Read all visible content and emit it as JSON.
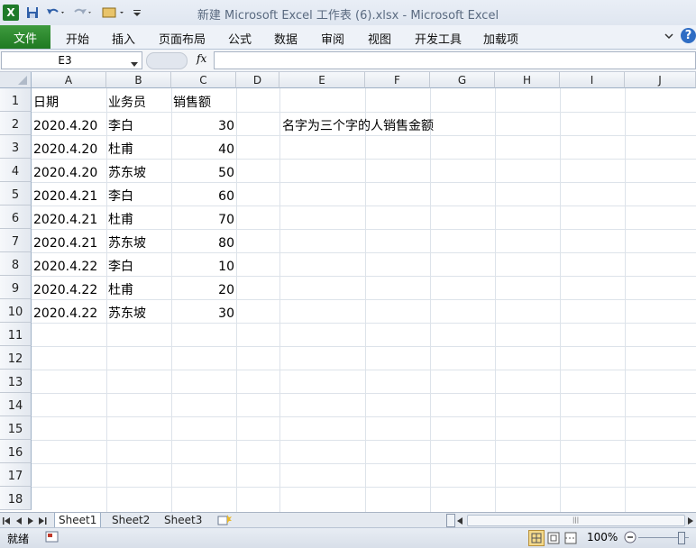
{
  "window": {
    "title": "新建 Microsoft Excel 工作表 (6).xlsx  -  Microsoft Excel"
  },
  "qat": {
    "save_icon": "save-icon",
    "undo_icon": "undo-icon",
    "redo_icon": "redo-icon"
  },
  "ribbon": {
    "file_tab": "文件",
    "tabs": [
      "开始",
      "插入",
      "页面布局",
      "公式",
      "数据",
      "审阅",
      "视图",
      "开发工具",
      "加载项"
    ]
  },
  "formula_bar": {
    "name_box": "E3",
    "fx": "fx",
    "value": ""
  },
  "columns": [
    "A",
    "B",
    "C",
    "D",
    "E",
    "F",
    "G",
    "H",
    "I",
    "J"
  ],
  "rows": [
    "1",
    "2",
    "3",
    "4",
    "5",
    "6",
    "7",
    "8",
    "9",
    "10",
    "11",
    "12",
    "13",
    "14",
    "15",
    "16",
    "17",
    "18"
  ],
  "cells": {
    "headers": [
      "日期",
      "业务员",
      "销售额"
    ],
    "data": [
      [
        "2020.4.20",
        "李白",
        "30"
      ],
      [
        "2020.4.20",
        "杜甫",
        "40"
      ],
      [
        "2020.4.20",
        "苏东坡",
        "50"
      ],
      [
        "2020.4.21",
        "李白",
        "60"
      ],
      [
        "2020.4.21",
        "杜甫",
        "70"
      ],
      [
        "2020.4.21",
        "苏东坡",
        "80"
      ],
      [
        "2020.4.22",
        "李白",
        "10"
      ],
      [
        "2020.4.22",
        "杜甫",
        "20"
      ],
      [
        "2020.4.22",
        "苏东坡",
        "30"
      ]
    ],
    "e2": "名字为三个字的人销售金额"
  },
  "sheets": [
    "Sheet1",
    "Sheet2",
    "Sheet3"
  ],
  "status": {
    "ready": "就绪",
    "zoom": "100%"
  },
  "colors": {
    "file_tab": "#2a8a2e",
    "grid_line": "#dde3ea",
    "header_bg": "#e3e8ef"
  }
}
